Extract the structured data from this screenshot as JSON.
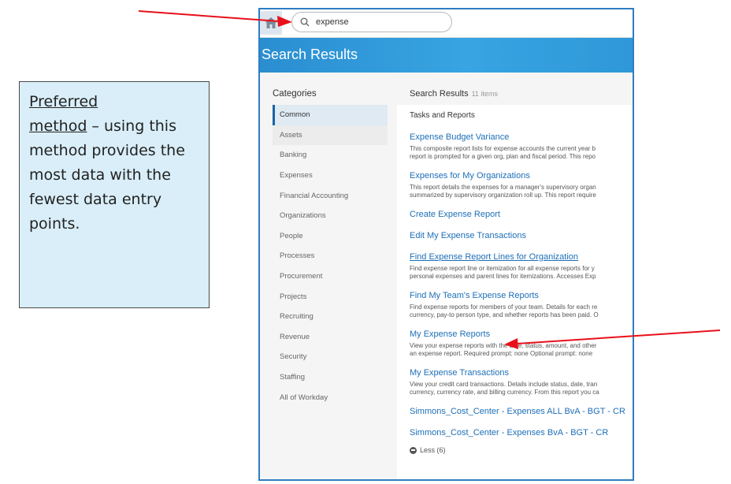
{
  "callout": {
    "title_line1": "Preferred",
    "title_line2": "method",
    "text_rest": " – using this method provides the most data with the fewest data entry points."
  },
  "topbar": {
    "search_value": "expense"
  },
  "header": {
    "title": "Search Results"
  },
  "categories": {
    "title": "Categories",
    "items": [
      "Common",
      "Assets",
      "Banking",
      "Expenses",
      "Financial Accounting",
      "Organizations",
      "People",
      "Processes",
      "Procurement",
      "Projects",
      "Recruiting",
      "Revenue",
      "Security",
      "Staffing",
      "All of Workday"
    ]
  },
  "results": {
    "title": "Search Results",
    "count": "11 items",
    "section": "Tasks and Reports",
    "items": [
      {
        "title": "Expense Budget Variance",
        "desc1": "This composite report lists for expense accounts the current year b",
        "desc2": "report is prompted for a given org, plan and fiscal period. This repo"
      },
      {
        "title": "Expenses for My Organizations",
        "desc1": "This report details the expenses for a manager's supervisory organ",
        "desc2": "summarized by supervisory organization roll up. This report require"
      },
      {
        "title": "Create Expense Report"
      },
      {
        "title": "Edit My Expense Transactions"
      },
      {
        "title": "Find Expense Report Lines for Organization",
        "desc1": "Find expense report line or itemization for all expense reports for y",
        "desc2": "personal expenses and parent lines for itemizations. Accesses Exp"
      },
      {
        "title": "Find My Team's Expense Reports",
        "desc1": "Find expense reports for members of your team. Details for each re",
        "desc2": "currency, pay-to person type, and whether reports has been paid. O"
      },
      {
        "title": "My Expense Reports",
        "desc1": "View your expense reports with the date, status, amount, and other",
        "desc2": "an expense report. Required prompt: none Optional prompt: none"
      },
      {
        "title": "My Expense Transactions",
        "desc1": "View your credit card transactions. Details include status, date, tran",
        "desc2": "currency, currency rate, and billing currency. From this report you ca"
      },
      {
        "title": "Simmons_Cost_Center - Expenses ALL BvA - BGT - CR"
      },
      {
        "title": "Simmons_Cost_Center - Expenses BvA - BGT - CR"
      }
    ],
    "less_label": "Less (6)"
  },
  "colors": {
    "arrow": "#e8101a",
    "link": "#1d6fb8",
    "header": "#2a8ed0",
    "frame": "#2f7dc1"
  }
}
